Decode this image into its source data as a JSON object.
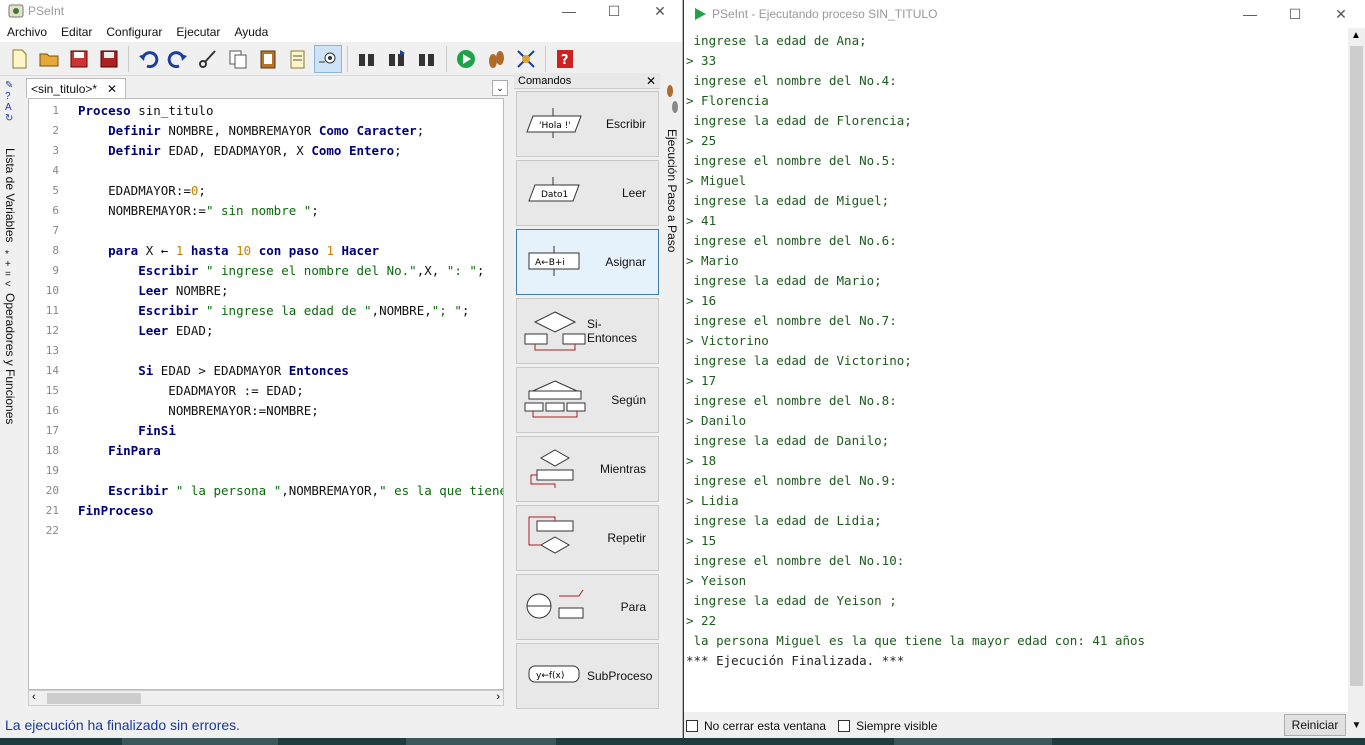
{
  "editor_window": {
    "title": "PSeInt",
    "menu": [
      "Archivo",
      "Editar",
      "Configurar",
      "Ejecutar",
      "Ayuda"
    ],
    "toolbar_icons": [
      "new-file-icon",
      "open-folder-icon",
      "save-icon",
      "save-as-icon",
      "undo-icon",
      "redo-icon",
      "cut-icon",
      "copy-icon",
      "paste-icon",
      "edit-icon",
      "indent-icon",
      "find-icon",
      "find-next-icon",
      "replace-icon",
      "run-icon",
      "step-icon",
      "debug-icon",
      "help-icon"
    ],
    "left_rail": {
      "variables": "Lista de Variables",
      "operators": "Operadores y Funciones"
    },
    "tab_label": "<sin_titulo>*",
    "tab_close": "✕",
    "code_lines": [
      {
        "n": "1",
        "html": "<span class='kw'>Proceso</span> sin_titulo"
      },
      {
        "n": "2",
        "html": "    <span class='kw'>Definir</span> NOMBRE, NOMBREMAYOR <span class='kw'>Como</span> <span class='kw'>Caracter</span>;"
      },
      {
        "n": "3",
        "html": "    <span class='kw'>Definir</span> EDAD, EDADMAYOR, X <span class='kw'>Como</span> <span class='kw'>Entero</span>;"
      },
      {
        "n": "4",
        "html": ""
      },
      {
        "n": "5",
        "html": "    EDADMAYOR:=<span class='num'>0</span>;"
      },
      {
        "n": "6",
        "html": "    NOMBREMAYOR:=<span class='str'>\" sin nombre \"</span>;"
      },
      {
        "n": "7",
        "html": ""
      },
      {
        "n": "8",
        "html": "    <span class='kw'>para</span> X ← <span class='num'>1</span> <span class='kw'>hasta</span> <span class='num'>10</span> <span class='kw'>con paso</span> <span class='num'>1</span> <span class='kw'>Hacer</span>"
      },
      {
        "n": "9",
        "html": "        <span class='kw'>Escribir</span> <span class='str'>\" ingrese el nombre del No.\"</span>,X, <span class='str'>\": \"</span>;"
      },
      {
        "n": "10",
        "html": "        <span class='kw'>Leer</span> NOMBRE;"
      },
      {
        "n": "11",
        "html": "        <span class='kw'>Escribir</span> <span class='str'>\" ingrese la edad de \"</span>,NOMBRE,<span class='str'>\"; \"</span>;"
      },
      {
        "n": "12",
        "html": "        <span class='kw'>Leer</span> EDAD;"
      },
      {
        "n": "13",
        "html": ""
      },
      {
        "n": "14",
        "html": "        <span class='kw'>Si</span> EDAD > EDADMAYOR <span class='kw'>Entonces</span>"
      },
      {
        "n": "15",
        "html": "            EDADMAYOR := EDAD;"
      },
      {
        "n": "16",
        "html": "            NOMBREMAYOR:=NOMBRE;"
      },
      {
        "n": "17",
        "html": "        <span class='kw'>FinSi</span>"
      },
      {
        "n": "18",
        "html": "    <span class='kw'>FinPara</span>"
      },
      {
        "n": "19",
        "html": ""
      },
      {
        "n": "20",
        "html": "    <span class='kw'>Escribir</span> <span class='str'>\" la persona \"</span>,NOMBREMAYOR,<span class='str'>\" es la que tiene l</span>"
      },
      {
        "n": "21",
        "html": "<span class='kw'>FinProceso</span>"
      },
      {
        "n": "22",
        "html": ""
      }
    ],
    "commands": {
      "title": "Comandos",
      "items": [
        {
          "label": "Escribir",
          "icon_text": "'Hola !'"
        },
        {
          "label": "Leer",
          "icon_text": "Dato1"
        },
        {
          "label": "Asignar",
          "icon_text": "A←B+i"
        },
        {
          "label": "Si-Entonces",
          "icon_text": ""
        },
        {
          "label": "Según",
          "icon_text": ""
        },
        {
          "label": "Mientras",
          "icon_text": ""
        },
        {
          "label": "Repetir",
          "icon_text": ""
        },
        {
          "label": "Para",
          "icon_text": ""
        },
        {
          "label": "SubProceso",
          "icon_text": "y←f(x)"
        }
      ]
    },
    "right_rail": "Ejecución Paso a Paso",
    "status": "La ejecución ha finalizado sin errores."
  },
  "run_window": {
    "title": "PSeInt - Ejecutando proceso SIN_TITULO",
    "console_lines": [
      " ingrese la edad de Ana;",
      "> 33",
      " ingrese el nombre del No.4:",
      "> Florencia",
      " ingrese la edad de Florencia;",
      "> 25",
      " ingrese el nombre del No.5:",
      "> Miguel",
      " ingrese la edad de Miguel;",
      "> 41",
      " ingrese el nombre del No.6:",
      "> Mario",
      " ingrese la edad de Mario;",
      "> 16",
      " ingrese el nombre del No.7:",
      "> Victorino",
      " ingrese la edad de Victorino;",
      "> 17",
      " ingrese el nombre del No.8:",
      "> Danilo",
      " ingrese la edad de Danilo;",
      "> 18",
      " ingrese el nombre del No.9:",
      "> Lidia",
      " ingrese la edad de Lidia;",
      "> 15",
      " ingrese el nombre del No.10:",
      "> Yeison",
      " ingrese la edad de Yeison ;",
      "> 22",
      " la persona Miguel es la que tiene la mayor edad con: 41 años",
      "*** Ejecución Finalizada. ***"
    ],
    "no_close_label": "No cerrar esta ventana",
    "always_visible_label": "Siempre visible",
    "restart_label": "Reiniciar"
  },
  "window_controls": {
    "minimize": "—",
    "maximize": "☐",
    "close": "✕"
  }
}
